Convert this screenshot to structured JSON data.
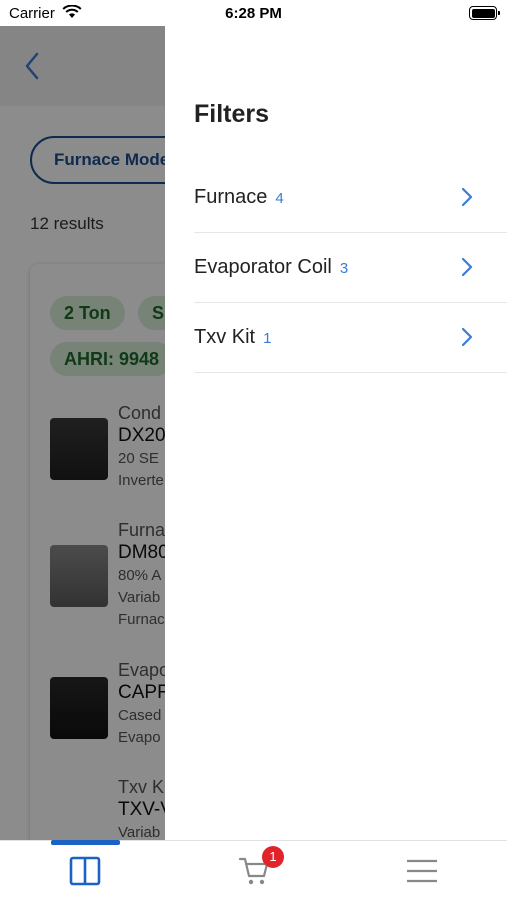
{
  "status_bar": {
    "carrier": "Carrier",
    "time": "6:28 PM"
  },
  "background": {
    "filter_pill": "Furnace Mode",
    "results_count": "12 results",
    "chips": [
      "2 Ton",
      "S",
      "AHRI: 9948"
    ],
    "items": [
      {
        "category": "Cond",
        "model": "DX20",
        "desc1": "20 SE",
        "desc2": "Inverte"
      },
      {
        "category": "Furna",
        "model": "DM80",
        "desc1": "80% A",
        "desc2": "Variab",
        "desc3": "Furnac"
      },
      {
        "category": "Evapo",
        "model": "CAPF",
        "desc1": "Cased",
        "desc2": "Evapo"
      },
      {
        "category": "Txv K",
        "model": "TXV-V",
        "desc1": "Variab"
      }
    ]
  },
  "drawer": {
    "title": "Filters",
    "filters": [
      {
        "name": "Furnace",
        "count": "4"
      },
      {
        "name": "Evaporator Coil",
        "count": "3"
      },
      {
        "name": "Txv Kit",
        "count": "1"
      }
    ]
  },
  "tab_bar": {
    "cart_badge": "1",
    "accent_color": "#1a62c6",
    "tabs": [
      "catalog-icon",
      "cart-icon",
      "menu-icon"
    ]
  }
}
